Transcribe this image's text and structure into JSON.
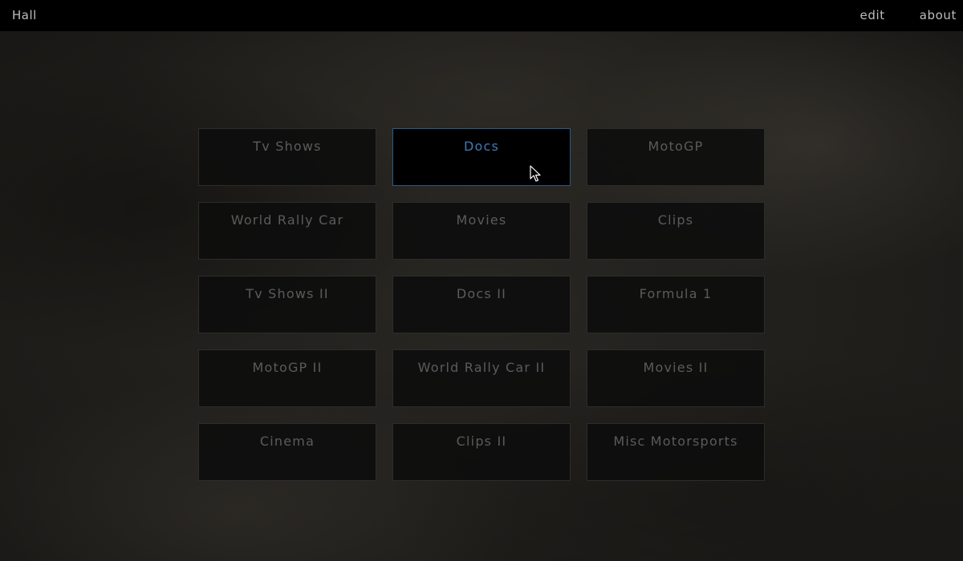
{
  "header": {
    "title": "Hall",
    "edit_label": "edit",
    "about_label": "about"
  },
  "tiles": [
    {
      "label": "Tv Shows",
      "active": false
    },
    {
      "label": "Docs",
      "active": true
    },
    {
      "label": "MotoGP",
      "active": false
    },
    {
      "label": "World Rally Car",
      "active": false
    },
    {
      "label": "Movies",
      "active": false
    },
    {
      "label": "Clips",
      "active": false
    },
    {
      "label": "Tv Shows II",
      "active": false
    },
    {
      "label": "Docs II",
      "active": false
    },
    {
      "label": "Formula 1",
      "active": false
    },
    {
      "label": "MotoGP II",
      "active": false
    },
    {
      "label": "World Rally Car II",
      "active": false
    },
    {
      "label": "Movies II",
      "active": false
    },
    {
      "label": "Cinema",
      "active": false
    },
    {
      "label": "Clips II",
      "active": false
    },
    {
      "label": "Misc Motorsports",
      "active": false
    }
  ],
  "colors": {
    "accent": "#3e7ab6",
    "tile_text": "#5b5b5b",
    "topbar_bg": "#000000"
  },
  "icons": {
    "cursor": "mouse-pointer-icon"
  }
}
